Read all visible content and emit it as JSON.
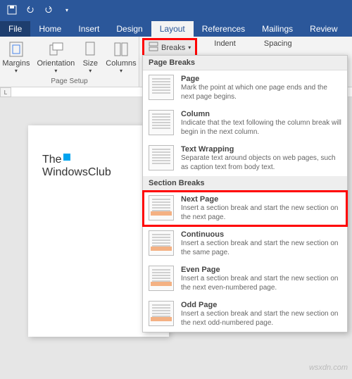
{
  "qat": {
    "save": "save",
    "undo": "undo",
    "redo": "redo"
  },
  "tabs": {
    "file": "File",
    "home": "Home",
    "insert": "Insert",
    "design": "Design",
    "layout": "Layout",
    "references": "References",
    "mailings": "Mailings",
    "review": "Review"
  },
  "ribbon": {
    "margins": "Margins",
    "orientation": "Orientation",
    "size": "Size",
    "columns": "Columns",
    "page_setup": "Page Setup",
    "breaks": "Breaks",
    "indent": "Indent",
    "spacing": "Spacing"
  },
  "dropdown": {
    "page_breaks_header": "Page Breaks",
    "section_breaks_header": "Section Breaks",
    "page": {
      "title": "Page",
      "desc": "Mark the point at which one page ends and the next page begins."
    },
    "column": {
      "title": "Column",
      "desc": "Indicate that the text following the column break will begin in the next column."
    },
    "text_wrapping": {
      "title": "Text Wrapping",
      "desc": "Separate text around objects on web pages, such as caption text from body text."
    },
    "next_page": {
      "title": "Next Page",
      "desc": "Insert a section break and start the new section on the next page."
    },
    "continuous": {
      "title": "Continuous",
      "desc": "Insert a section break and start the new section on the same page."
    },
    "even_page": {
      "title": "Even Page",
      "desc": "Insert a section break and start the new section on the next even-numbered page."
    },
    "odd_page": {
      "title": "Odd Page",
      "desc": "Insert a section break and start the new section on the next odd-numbered page."
    }
  },
  "document": {
    "logo1": "The",
    "logo2": "WindowsClub"
  },
  "watermark": "wsxdn.com"
}
